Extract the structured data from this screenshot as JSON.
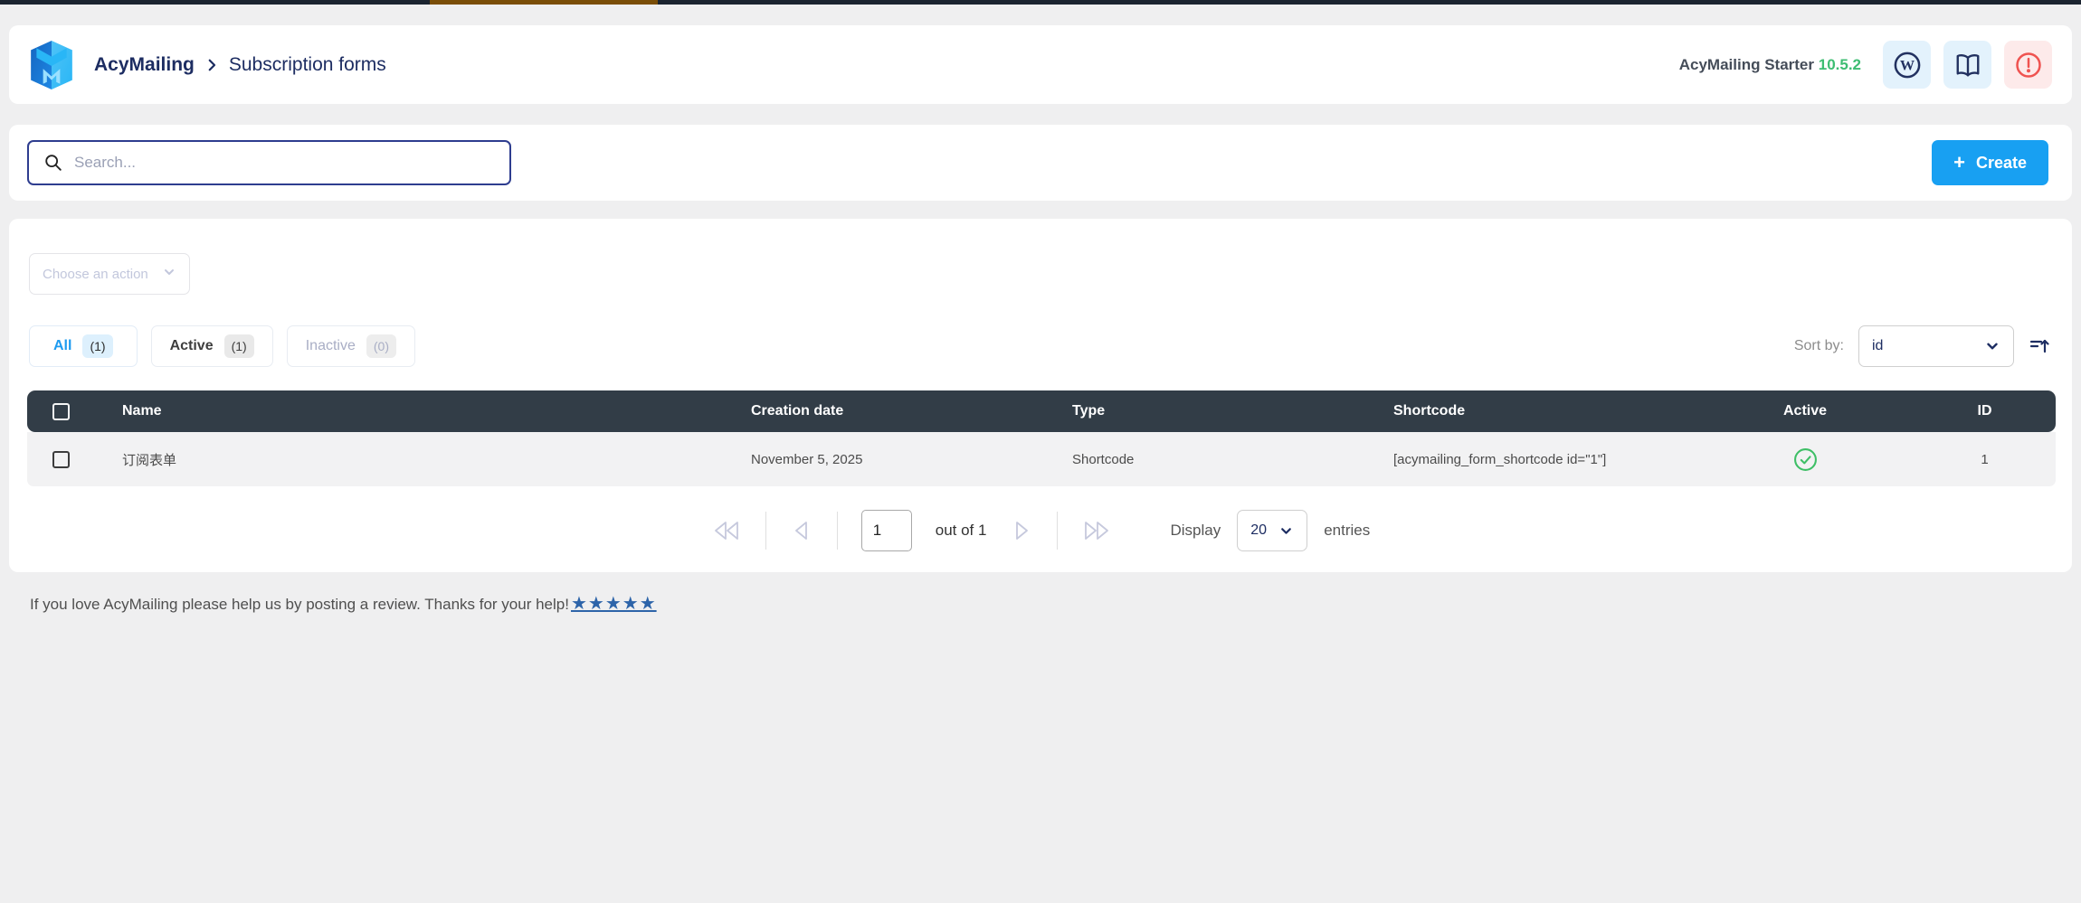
{
  "breadcrumb": {
    "root": "AcyMailing",
    "page": "Subscription forms",
    "separator": ">"
  },
  "header": {
    "plan_label": "AcyMailing Starter",
    "version": "10.5.2",
    "wordpress_glyph": "W"
  },
  "search": {
    "placeholder": "Search..."
  },
  "toolbar": {
    "create_label": "Create",
    "create_plus": "+"
  },
  "bulk": {
    "action_placeholder": "Choose an action"
  },
  "filters": {
    "items": [
      {
        "label": "All",
        "count": "(1)"
      },
      {
        "label": "Active",
        "count": "(1)"
      },
      {
        "label": "Inactive",
        "count": "(0)"
      }
    ]
  },
  "sort": {
    "label": "Sort by:",
    "selected": "id"
  },
  "table": {
    "columns": {
      "name": "Name",
      "creation_date": "Creation date",
      "type": "Type",
      "shortcode": "Shortcode",
      "active": "Active",
      "id": "ID"
    },
    "rows": [
      {
        "name": "订阅表单",
        "creation_date": "November 5, 2025",
        "type": "Shortcode",
        "shortcode": "[acymailing_form_shortcode id=\"1\"]",
        "active": "true",
        "id": "1"
      }
    ]
  },
  "pagination": {
    "page": "1",
    "of_label": "out of 1",
    "display_label": "Display",
    "per_page": "20",
    "entries_label": "entries"
  },
  "footer": {
    "message": "If you love AcyMailing please help us by posting a review. Thanks for your help!",
    "stars": "★★★★★"
  },
  "colors": {
    "accent_blue": "#18a0f2",
    "navy_text": "#1d2d62",
    "version_green": "#3dbd72",
    "check_green": "#3ebf66",
    "table_header_bg": "#323d47",
    "alert_red": "#ef5350",
    "topbar_dark": "#1b2430",
    "topbar_brown": "#7a4e07",
    "page_bg": "#efeff0"
  }
}
